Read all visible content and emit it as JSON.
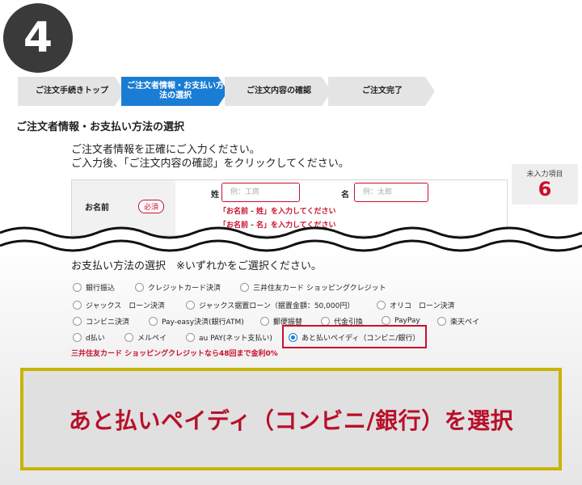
{
  "step_number": "4",
  "steps": [
    {
      "label": "ご注文手続きトップ",
      "active": false
    },
    {
      "label": "ご注文者情報・お支払い方法の選択",
      "active": true
    },
    {
      "label": "ご注文内容の確認",
      "active": false
    },
    {
      "label": "ご注文完了",
      "active": false
    }
  ],
  "section_title": "ご注文者情報・お支払い方法の選択",
  "instructions": {
    "line1": "ご注文者情報を正確にご入力ください。",
    "line2": "ご入力後、「ご注文内容の確認」をクリックしてください。"
  },
  "name_form": {
    "label": "お名前",
    "required": "必須",
    "last_label": "姓",
    "last_placeholder": "例：工房",
    "first_label": "名",
    "first_placeholder": "例：太郎",
    "error_last": "「お名前 - 姓」を入力してください",
    "error_first": "「お名前 - 名」を入力してください"
  },
  "unfilled": {
    "label": "未入力項目",
    "count": "6"
  },
  "payment": {
    "title": "お支払い方法の選択　※いずれかをご選択ください。",
    "options": [
      {
        "label": "銀行振込",
        "checked": false
      },
      {
        "label": "クレジットカード決済",
        "checked": false
      },
      {
        "label": "三井住友カード ショッピングクレジット",
        "checked": false
      },
      {
        "label": "ジャックス　ローン決済",
        "checked": false
      },
      {
        "label": "ジャックス据置ローン（据置金額：50,000円）",
        "checked": false
      },
      {
        "label": "オリコ　ローン決済",
        "checked": false
      },
      {
        "label": "コンビニ決済",
        "checked": false
      },
      {
        "label": "Pay-easy決済(銀行ATM)",
        "checked": false
      },
      {
        "label": "郵便振替",
        "checked": false
      },
      {
        "label": "代金引換",
        "checked": false
      },
      {
        "label": "PayPay",
        "checked": false
      },
      {
        "label": "楽天ペイ",
        "checked": false
      },
      {
        "label": "d払い",
        "checked": false
      },
      {
        "label": "メルペイ",
        "checked": false
      },
      {
        "label": "au PAY(ネット支払い)",
        "checked": false
      },
      {
        "label": "あと払いペイディ（コンビニ/銀行）",
        "checked": true
      }
    ],
    "promo": "三井住友カード ショッピングクレジットなら48回まで金利0%"
  },
  "callout": "あと払いペイディ（コンビニ/銀行）を選択",
  "colors": {
    "accent": "#1a7dd4",
    "error": "#c8102e",
    "callout_border": "#c8b400"
  }
}
